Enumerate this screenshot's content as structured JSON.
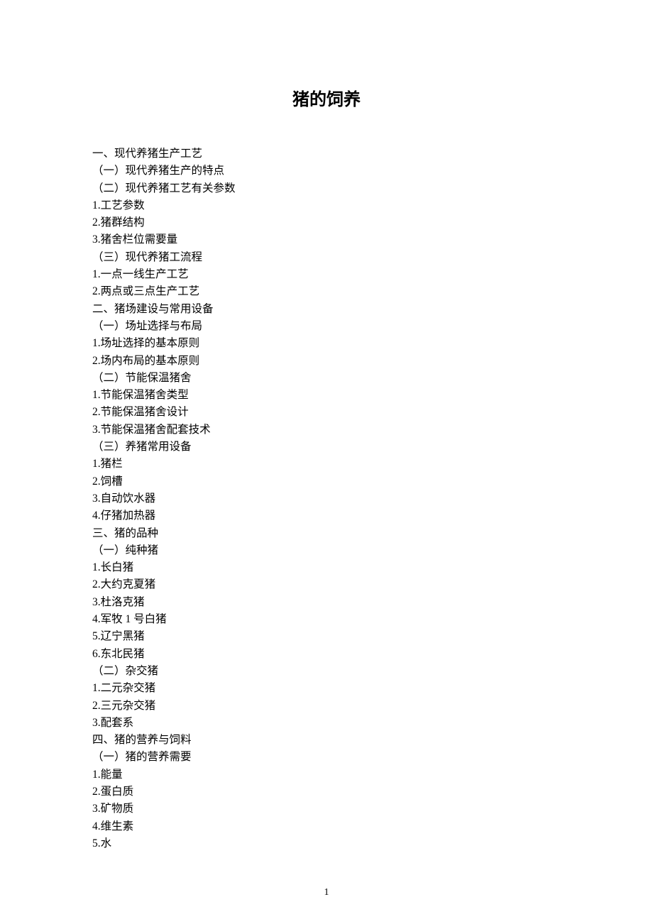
{
  "title": "猪的饲养",
  "toc": [
    "一、现代养猪生产工艺",
    "（一）现代养猪生产的特点",
    "（二）现代养猪工艺有关参数",
    "1.工艺参数",
    "2.猪群结构",
    "3.猪舍栏位需要量",
    "（三）现代养猪工流程",
    "1.一点一线生产工艺",
    "2.两点或三点生产工艺",
    "二、猪场建设与常用设备",
    "（一）场址选择与布局",
    "1.场址选择的基本原则",
    "2.场内布局的基本原则",
    "（二）节能保温猪舍",
    "1.节能保温猪舍类型",
    "2.节能保温猪舍设计",
    "3.节能保温猪舍配套技术",
    "（三）养猪常用设备",
    "1.猪栏",
    "2.饲槽",
    "3.自动饮水器",
    "4.仔猪加热器",
    "三、猪的品种",
    "（一）纯种猪",
    "1.长白猪",
    "2.大约克夏猪",
    "3.杜洛克猪",
    "4.军牧 1 号白猪",
    "5.辽宁黑猪",
    "6.东北民猪",
    "（二）杂交猪",
    "1.二元杂交猪",
    "2.三元杂交猪",
    "3.配套系",
    "四、猪的营养与饲料",
    "（一）猪的营养需要",
    "1.能量",
    "2.蛋白质",
    "3.矿物质",
    "4.维生素",
    "5.水"
  ],
  "pageNumber": "1"
}
